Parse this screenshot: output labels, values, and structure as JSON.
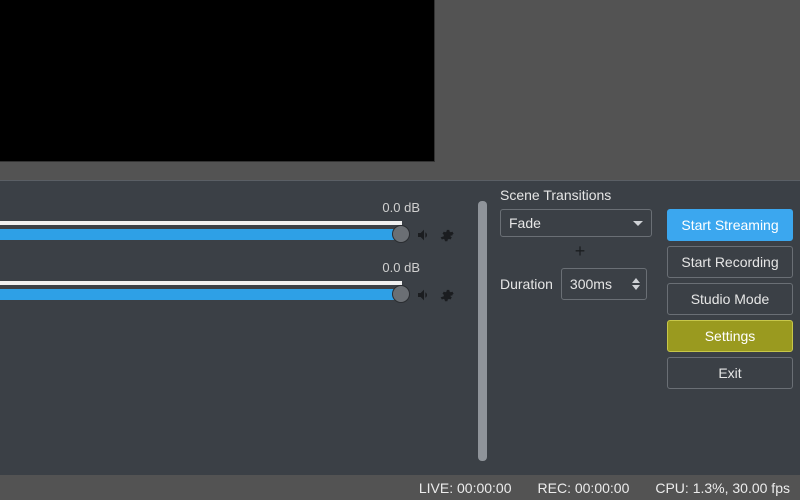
{
  "mixer": {
    "channels": [
      {
        "db": "0.0 dB"
      },
      {
        "db": "0.0 dB"
      }
    ]
  },
  "transitions": {
    "title": "Scene Transitions",
    "selected": "Fade",
    "duration_label": "Duration",
    "duration_value": "300ms"
  },
  "controls": {
    "start_streaming": "Start Streaming",
    "start_recording": "Start Recording",
    "studio_mode": "Studio Mode",
    "settings": "Settings",
    "exit": "Exit"
  },
  "status": {
    "live": "LIVE: 00:00:00",
    "rec": "REC: 00:00:00",
    "cpu": "CPU: 1.3%, 30.00 fps"
  },
  "colors": {
    "accent": "#3ba7ef",
    "highlight": "#9a9a1f",
    "meter": "#2ea0e6",
    "panel": "#3b4046"
  }
}
